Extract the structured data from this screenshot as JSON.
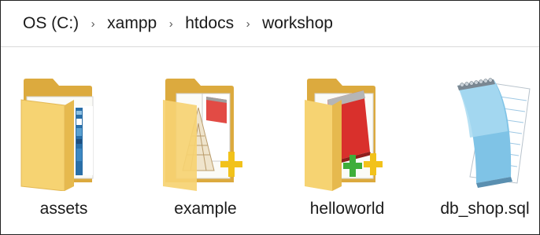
{
  "breadcrumb": {
    "items": [
      "OS (C:)",
      "xampp",
      "htdocs",
      "workshop"
    ],
    "separator": "›"
  },
  "files": [
    {
      "name": "assets",
      "type": "folder",
      "icon": "folder-icon"
    },
    {
      "name": "example",
      "type": "folder",
      "icon": "folder-icon"
    },
    {
      "name": "helloworld",
      "type": "folder",
      "icon": "folder-icon"
    },
    {
      "name": "db_shop.sql",
      "type": "file",
      "icon": "notepad-file-icon"
    }
  ],
  "colors": {
    "folder_back": "#e8b94a",
    "folder_front": "#f7d675",
    "notepad_blue": "#7fc3e6",
    "red_notepad": "#d9302c",
    "plus_yellow": "#f2c21a",
    "plus_green": "#3fae3a"
  }
}
